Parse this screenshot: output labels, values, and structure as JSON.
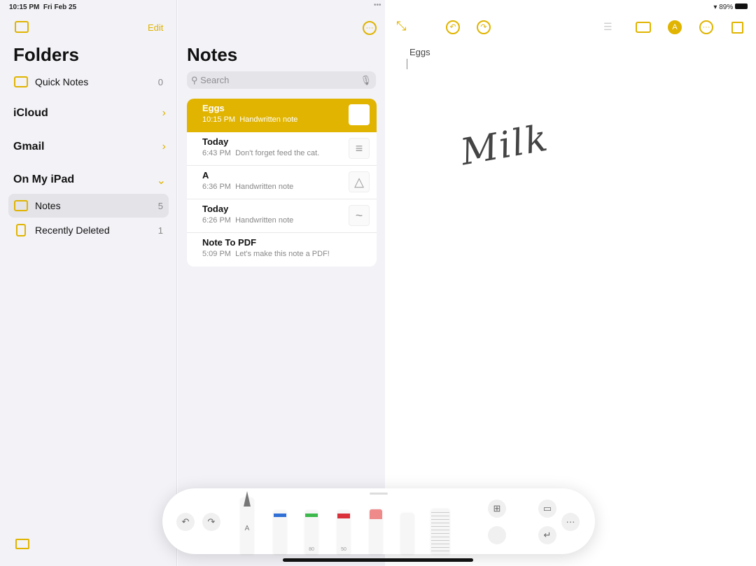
{
  "status": {
    "time": "10:15 PM",
    "date": "Fri Feb 25",
    "battery": "89%"
  },
  "sidebar": {
    "edit": "Edit",
    "title": "Folders",
    "quick_notes": {
      "label": "Quick Notes",
      "count": "0"
    },
    "sections": [
      "iCloud",
      "Gmail",
      "On My iPad"
    ],
    "folders": [
      {
        "label": "Notes",
        "count": "5"
      },
      {
        "label": "Recently Deleted",
        "count": "1"
      }
    ]
  },
  "list": {
    "title": "Notes",
    "search_placeholder": "Search",
    "notes": [
      {
        "title": "Eggs",
        "time": "10:15 PM",
        "preview": "Handwritten note"
      },
      {
        "title": "Today",
        "time": "6:43 PM",
        "preview": "Don't forget feed the cat."
      },
      {
        "title": "A",
        "time": "6:36 PM",
        "preview": "Handwritten note"
      },
      {
        "title": "Today",
        "time": "6:26 PM",
        "preview": "Handwritten note"
      },
      {
        "title": "Note To PDF",
        "time": "5:09 PM",
        "preview": "Let's make this note a PDF!"
      }
    ]
  },
  "editor": {
    "note_title": "Eggs",
    "handwriting": "Milk"
  },
  "palette": {
    "pencil_label": "A",
    "marker_labels": [
      "80",
      "50"
    ]
  },
  "colors": {
    "accent": "#e0b400",
    "pen": "#2f6fd6",
    "marker": "#3cb94a",
    "crayon": "#d9303a"
  }
}
